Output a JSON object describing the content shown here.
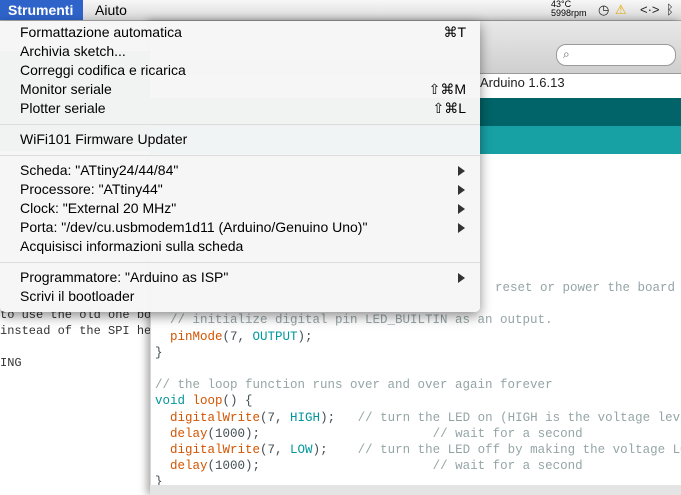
{
  "menubar": {
    "strumenti": "Strumenti",
    "aiuto": "Aiuto",
    "temp": "43°C",
    "rpm": "5998rpm"
  },
  "window": {
    "title": "Arduino 1.6.13",
    "search_placeholder": ""
  },
  "left_code": [
    "to use the old one bo",
    "instead of the SPI hea",
    "",
    "ING"
  ],
  "menu": {
    "items": [
      {
        "label": "Formattazione automatica",
        "shortcut": "⌘T",
        "submenu": false
      },
      {
        "label": "Archivia sketch...",
        "shortcut": "",
        "submenu": false
      },
      {
        "label": "Correggi codifica e ricarica",
        "shortcut": "",
        "submenu": false
      },
      {
        "label": "Monitor seriale",
        "shortcut": "⇧⌘M",
        "submenu": false
      },
      {
        "label": "Plotter seriale",
        "shortcut": "⇧⌘L",
        "submenu": false
      },
      {
        "label": "WiFi101 Firmware Updater",
        "shortcut": "",
        "submenu": false
      },
      {
        "label": "Scheda: \"ATtiny24/44/84\"",
        "shortcut": "",
        "submenu": true
      },
      {
        "label": "Processore: \"ATtiny44\"",
        "shortcut": "",
        "submenu": true
      },
      {
        "label": "Clock: \"External 20 MHz\"",
        "shortcut": "",
        "submenu": true
      },
      {
        "label": "Porta: \"/dev/cu.usbmodem1d11 (Arduino/Genuino Uno)\"",
        "shortcut": "",
        "submenu": true
      },
      {
        "label": "Acquisisci informazioni sulla scheda",
        "shortcut": "",
        "submenu": false
      },
      {
        "label": "Programmatore: \"Arduino as ISP\"",
        "shortcut": "",
        "submenu": true
      },
      {
        "label": "Scrivi il bootloader",
        "shortcut": "",
        "submenu": false
      }
    ]
  },
  "code": {
    "l0": "reset or power the board",
    "l1": "  // initialize digital pin LED_BUILTIN as an output.",
    "l2a": "  pinMode",
    "l2b": "(7, ",
    "l2c": "OUTPUT",
    "l2d": ");",
    "l3": "}",
    "l4": "",
    "l5": "// the loop function runs over and over again forever",
    "l6a": "void",
    "l6b": " ",
    "l6c": "loop",
    "l6d": "() {",
    "l7a": "  digitalWrite",
    "l7b": "(7, ",
    "l7c": "HIGH",
    "l7d": ");   ",
    "l7e": "// turn the LED on (HIGH is the voltage level)",
    "l8a": "  delay",
    "l8b": "(1000);                       ",
    "l8c": "// wait for a second",
    "l9a": "  digitalWrite",
    "l9b": "(7, ",
    "l9c": "LOW",
    "l9d": ");    ",
    "l9e": "// turn the LED off by making the voltage LOW",
    "l10a": "  delay",
    "l10b": "(1000);                       ",
    "l10c": "// wait for a second",
    "l11": "}"
  }
}
